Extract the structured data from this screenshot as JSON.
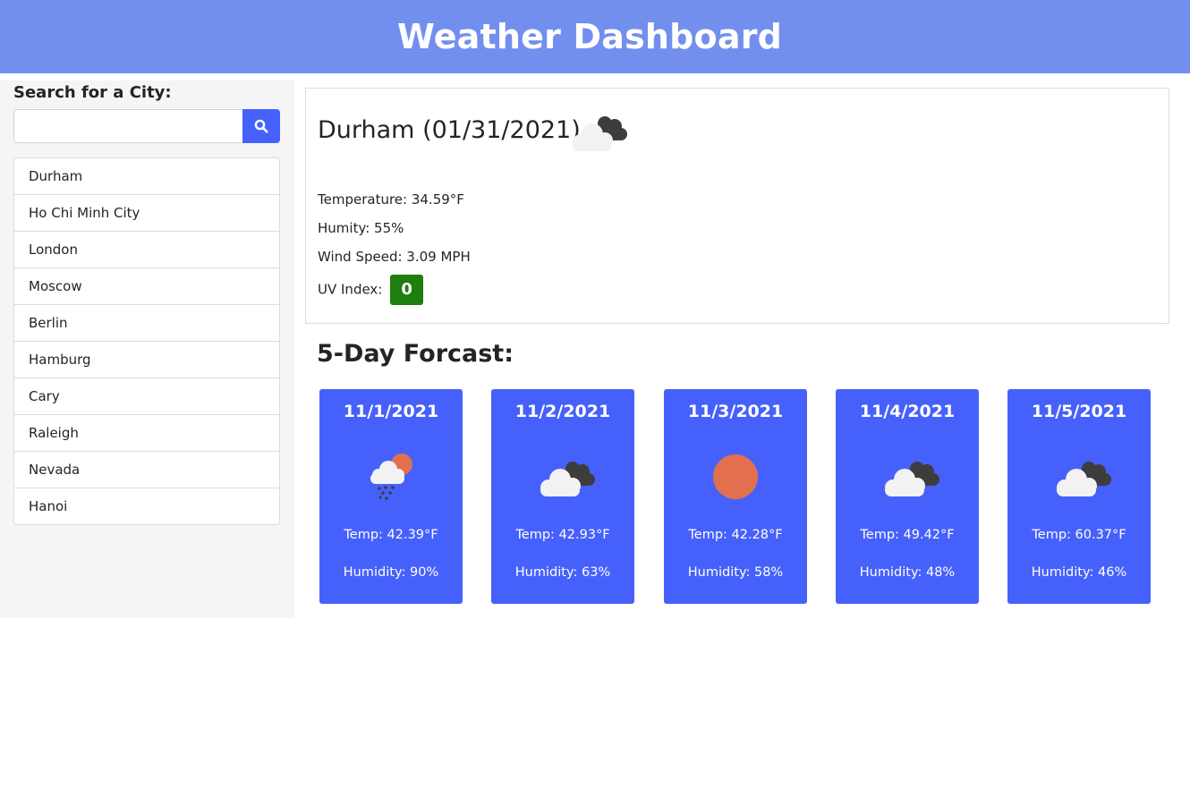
{
  "header": {
    "title": "Weather Dashboard"
  },
  "search": {
    "label": "Search for a City:",
    "value": "",
    "placeholder": "",
    "button_icon": "search-icon"
  },
  "history": [
    {
      "label": "Durham"
    },
    {
      "label": "Ho Chi Minh City"
    },
    {
      "label": "London"
    },
    {
      "label": "Moscow"
    },
    {
      "label": "Berlin"
    },
    {
      "label": "Hamburg"
    },
    {
      "label": "Cary"
    },
    {
      "label": "Raleigh"
    },
    {
      "label": "Nevada"
    },
    {
      "label": "Hanoi"
    }
  ],
  "current": {
    "title": "Durham (01/31/2021)",
    "icon": "cloudy-icon",
    "temperature": "Temperature: 34.59°F",
    "humidity": "Humity: 55%",
    "wind": "Wind Speed: 3.09 MPH",
    "uv_label": "UV Index:",
    "uv_value": "0",
    "uv_color": "#1e7e0e"
  },
  "forecast": {
    "title": "5-Day Forcast:",
    "days": [
      {
        "date": "11/1/2021",
        "icon": "rain-sun-icon",
        "temp": "Temp: 42.39°F",
        "humidity": "Humidity: 90%"
      },
      {
        "date": "11/2/2021",
        "icon": "cloudy-icon",
        "temp": "Temp: 42.93°F",
        "humidity": "Humidity: 63%"
      },
      {
        "date": "11/3/2021",
        "icon": "sun-icon",
        "temp": "Temp: 42.28°F",
        "humidity": "Humidity: 58%"
      },
      {
        "date": "11/4/2021",
        "icon": "cloudy-icon",
        "temp": "Temp: 49.42°F",
        "humidity": "Humidity: 48%"
      },
      {
        "date": "11/5/2021",
        "icon": "cloudy-icon",
        "temp": "Temp: 60.37°F",
        "humidity": "Humidity: 46%"
      }
    ]
  },
  "colors": {
    "header": "#738fee",
    "accent": "#4661fb",
    "sidebar": "#f5f5f5",
    "uv_low": "#1e7e0e",
    "sun": "#e2704e"
  }
}
